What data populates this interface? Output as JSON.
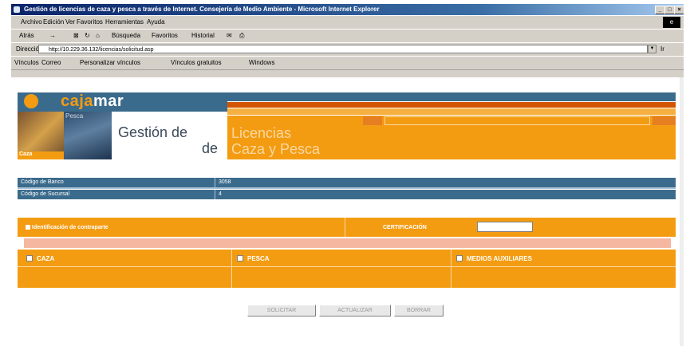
{
  "window": {
    "title": "Gestión de licencias de caza y pesca a través de Internet. Consejería de Medio Ambiente - Microsoft Internet Explorer",
    "controls": [
      "_",
      "□",
      "×"
    ]
  },
  "menubar": {
    "items": [
      "Archivo",
      "Edición",
      "Ver",
      "Favoritos",
      "Herramientas",
      "Ayuda"
    ]
  },
  "toolbar": {
    "back": "Atrás",
    "forward": "→",
    "search": "Búsqueda",
    "favorites": "Favoritos",
    "history": "Historial"
  },
  "addressbar": {
    "label": "Dirección",
    "url": "http://10.229.36.132/licencias/solicitud.asp",
    "go": "Ir"
  },
  "linksbar": {
    "label": "Vínculos",
    "links": [
      "Correo",
      "Personalizar vínculos",
      "Vínculos gratuitos",
      "Windows"
    ]
  },
  "banner": {
    "logo_ca": "caja",
    "logo_rest": "mar",
    "stripe_text": "",
    "photo1_label": "Caza",
    "photo2_label": "Pesca",
    "gestion_line1": "Gestión de",
    "gestion_line2": "de",
    "licencias_line1": "Licencias",
    "licencias_line2": "Caza y Pesca"
  },
  "info": {
    "rows": [
      {
        "label": "Código de Banco",
        "value": "3058"
      },
      {
        "label": "Código de Sucursal",
        "value": "4"
      }
    ]
  },
  "form": {
    "identificacion_label": "Identificación de contraparte",
    "certificacion_label": "CERTIFICACIÓN",
    "certificacion_value": "",
    "options": [
      {
        "label": "CAZA"
      },
      {
        "label": "PESCA"
      },
      {
        "label": "MEDIOS AUXILIARES"
      }
    ]
  },
  "buttons": {
    "solicitar": "SOLICITAR",
    "actualizar": "ACTUALIZAR",
    "borrar": "BORRAR"
  },
  "colors": {
    "accent": "#f39c12",
    "primary": "#3b6b8c",
    "highlight": "#d35400"
  }
}
